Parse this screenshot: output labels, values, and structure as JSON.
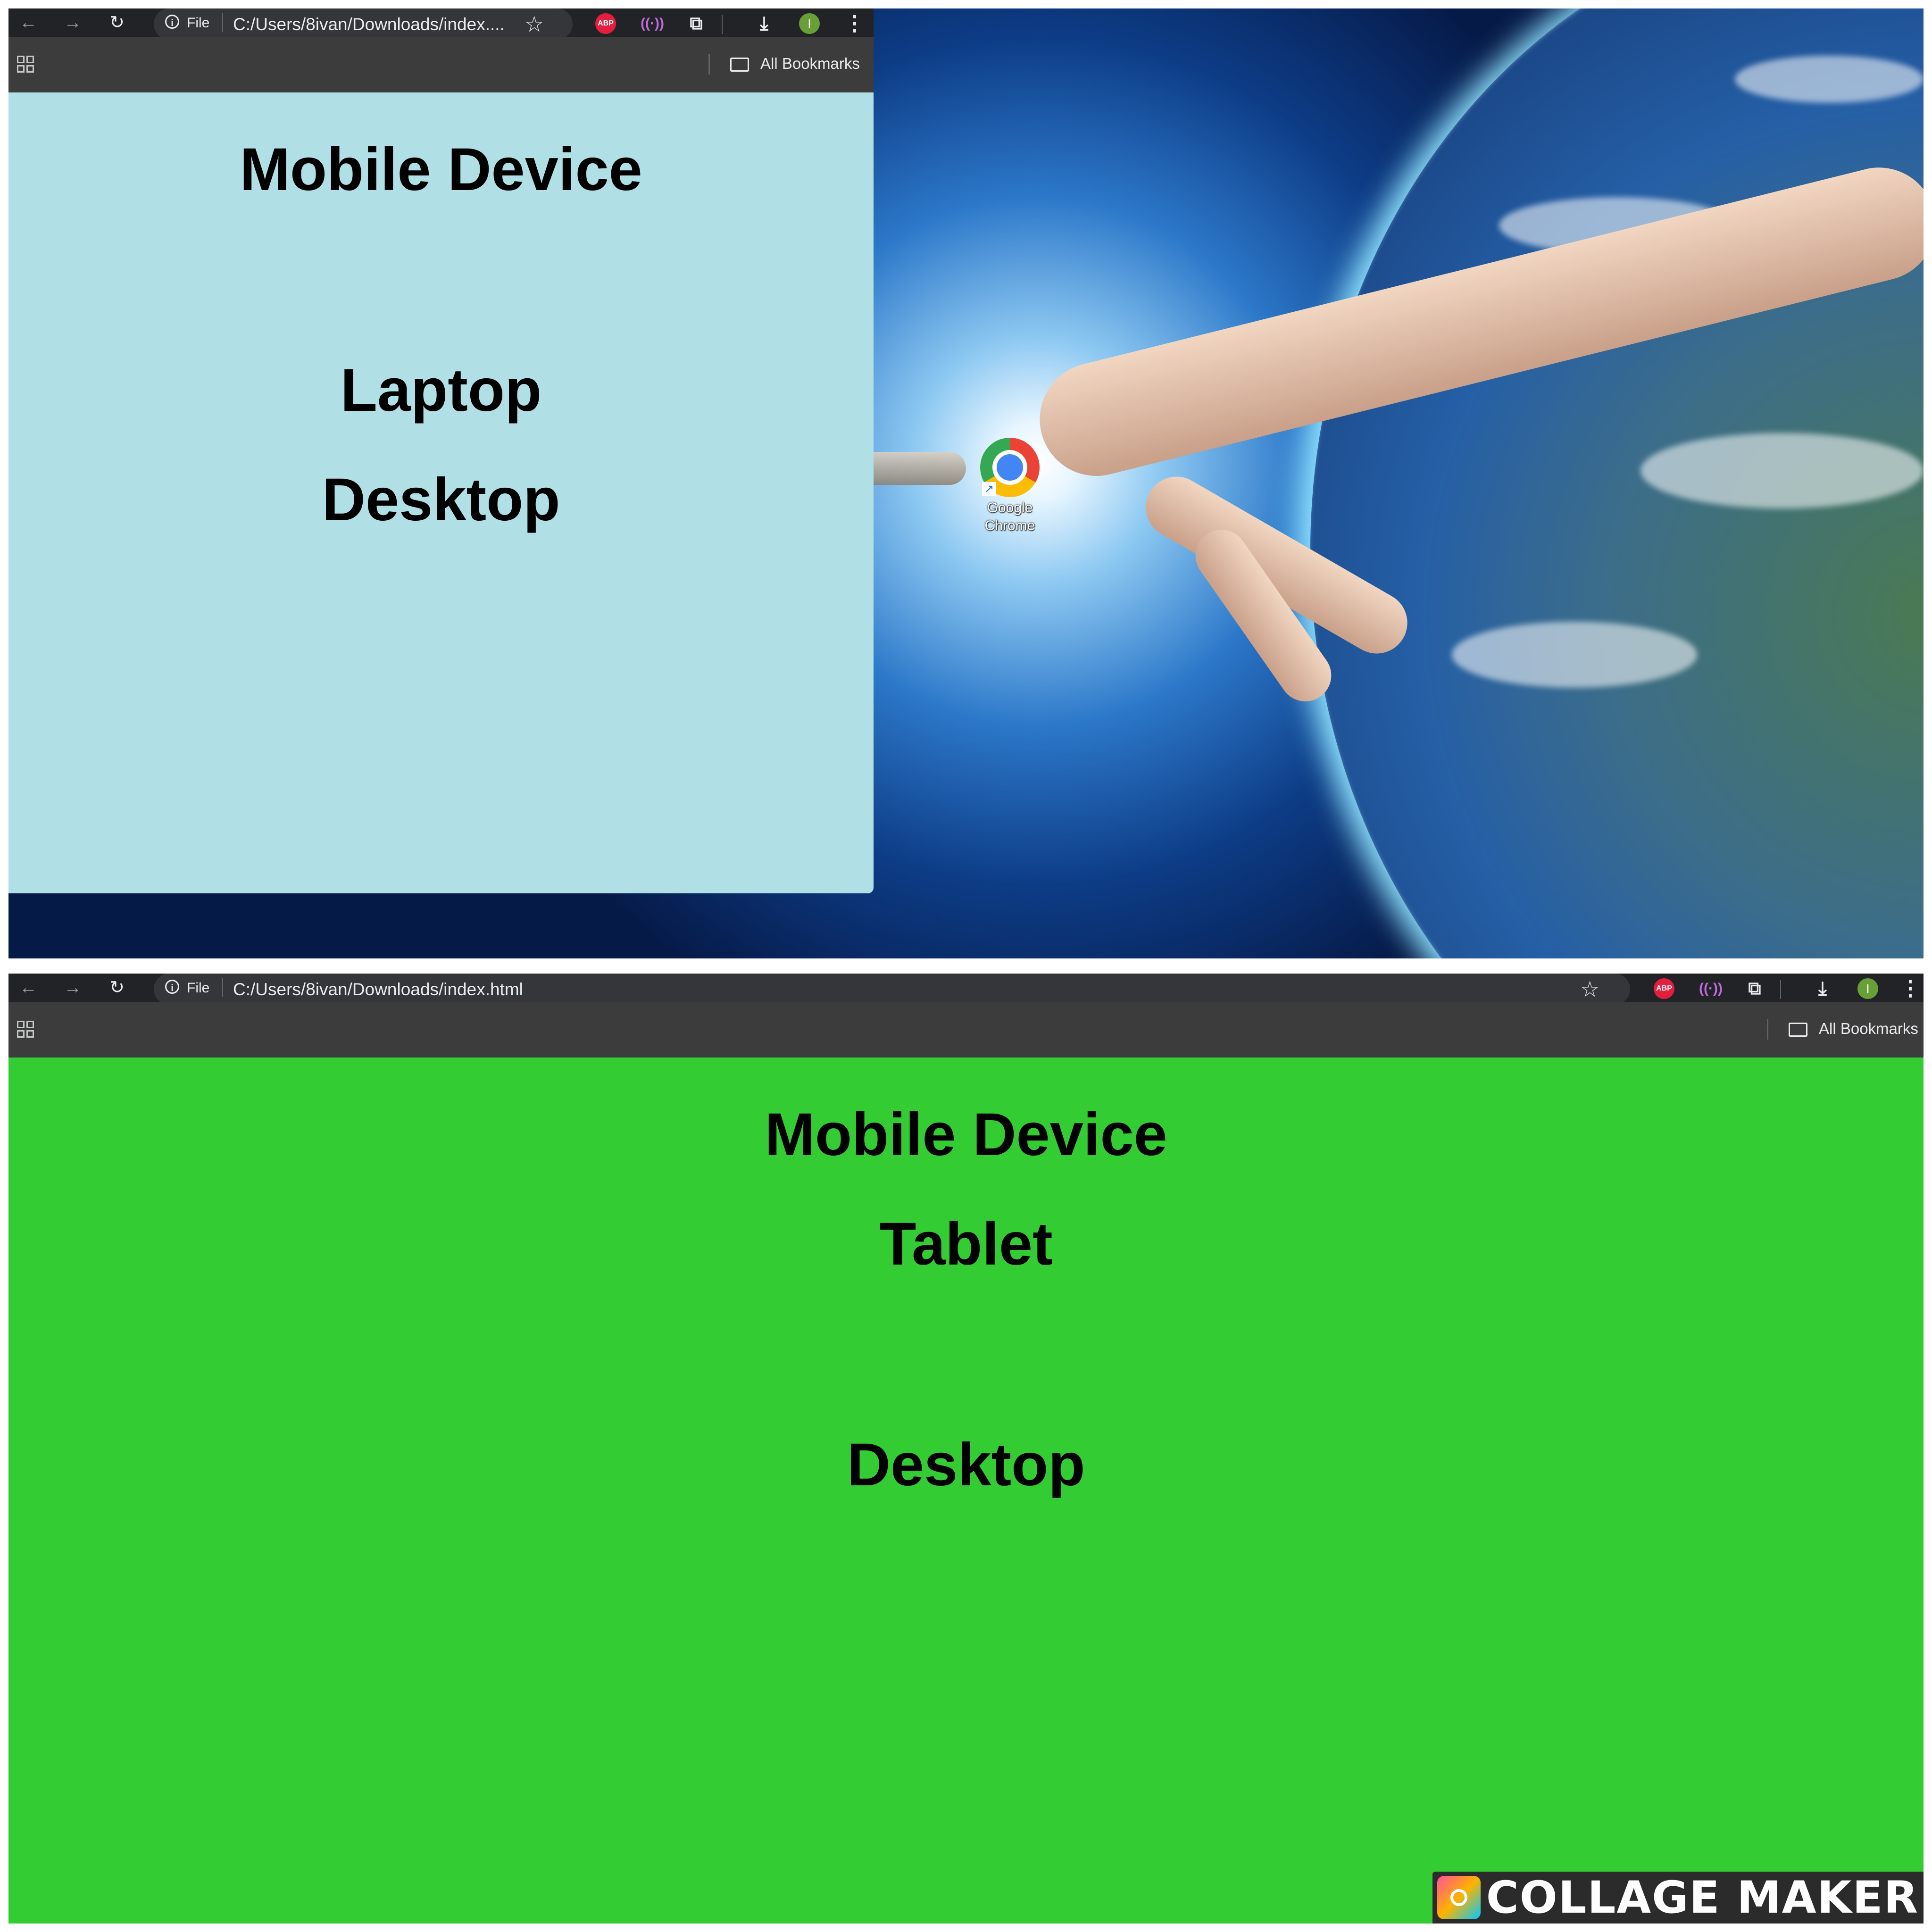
{
  "top_screenshot": {
    "browser": {
      "info_label": "File",
      "url": "C:/Users/8ivan/Downloads/index....",
      "bookmarks_label": "All Bookmarks",
      "abp_label": "ABP",
      "avatar_initial": "I"
    },
    "page": {
      "background": "#b0e0e6",
      "headings": [
        "Mobile Device",
        "Laptop",
        "Desktop"
      ]
    },
    "desktop_icon": {
      "label_line1": "Google",
      "label_line2": "Chrome"
    }
  },
  "bottom_screenshot": {
    "browser": {
      "info_label": "File",
      "url": "C:/Users/8ivan/Downloads/index.html",
      "bookmarks_label": "All Bookmarks",
      "abp_label": "ABP",
      "avatar_initial": "I"
    },
    "page": {
      "background": "#33cc33",
      "headings": [
        "Mobile Device",
        "Tablet",
        "Desktop"
      ]
    }
  },
  "watermark": {
    "text": "COLLAGE MAKER"
  },
  "icons": [
    "back-arrow-icon",
    "forward-arrow-icon",
    "reload-icon",
    "info-icon",
    "star-icon",
    "abp-extension-icon",
    "wave-extension-icon",
    "puzzle-extensions-icon",
    "download-icon",
    "profile-avatar",
    "kebab-menu-icon",
    "apps-grid-icon",
    "folder-icon",
    "chrome-icon"
  ]
}
